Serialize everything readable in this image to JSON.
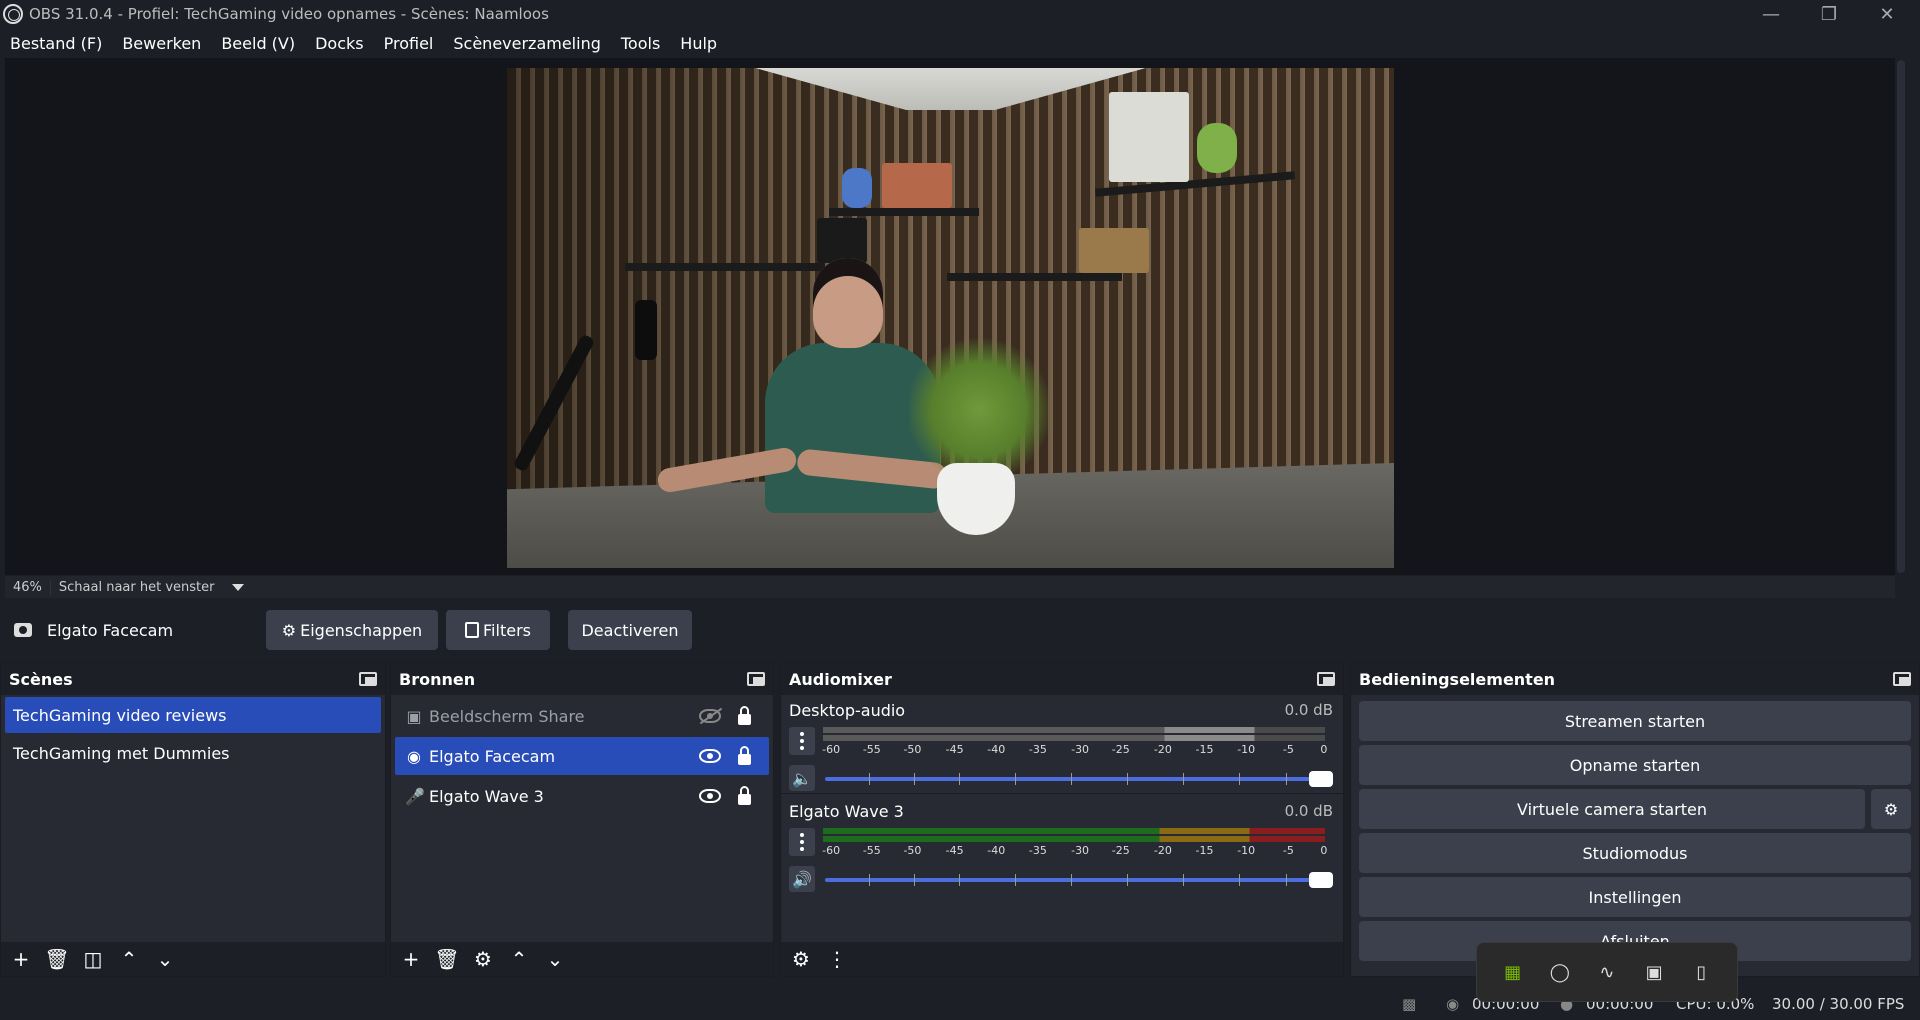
{
  "window": {
    "title": "OBS 31.0.4 - Profiel: TechGaming video opnames - Scènes: Naamloos"
  },
  "menu": [
    "Bestand (F)",
    "Bewerken",
    "Beeld (V)",
    "Docks",
    "Profiel",
    "Scèneverzameling",
    "Tools",
    "Hulp"
  ],
  "zoom": {
    "percent": "46%",
    "mode": "Schaal naar het venster"
  },
  "source_toolbar": {
    "selected_source": "Elgato Facecam",
    "properties_label": "Eigenschappen",
    "filters_label": "Filters",
    "deactivate_label": "Deactiveren"
  },
  "scenes": {
    "title": "Scènes",
    "items": [
      {
        "label": "TechGaming video reviews",
        "selected": true
      },
      {
        "label": "TechGaming met Dummies",
        "selected": false
      }
    ]
  },
  "sources": {
    "title": "Bronnen",
    "items": [
      {
        "label": "Beeldscherm Share",
        "icon": "monitor-icon",
        "visible": false
      },
      {
        "label": "Elgato Facecam",
        "icon": "camera-icon",
        "visible": true,
        "selected": true
      },
      {
        "label": "Elgato Wave 3",
        "icon": "microphone-icon",
        "visible": true
      }
    ]
  },
  "audiomixer": {
    "title": "Audiomixer",
    "channels": [
      {
        "name": "Desktop-audio",
        "db": "0.0 dB",
        "muted": true
      },
      {
        "name": "Elgato Wave 3",
        "db": "0.0 dB",
        "muted": false
      }
    ],
    "scale": [
      "-60",
      "-55",
      "-50",
      "-45",
      "-40",
      "-35",
      "-30",
      "-25",
      "-20",
      "-15",
      "-10",
      "-5",
      "0"
    ]
  },
  "controls": {
    "title": "Bedieningselementen",
    "stream": "Streamen starten",
    "record": "Opname starten",
    "virtualcam": "Virtuele camera starten",
    "studio": "Studiomodus",
    "settings": "Instellingen",
    "exit": "Afsluiten"
  },
  "status": {
    "rec_time": "00:00:00",
    "stream_time": "00:00:00",
    "cpu": "CPU: 0.0%",
    "fps": "30.00 / 30.00 FPS"
  },
  "colors": {
    "selection": "#284cb8",
    "button": "#3c404d",
    "background": "#1d1f26"
  }
}
